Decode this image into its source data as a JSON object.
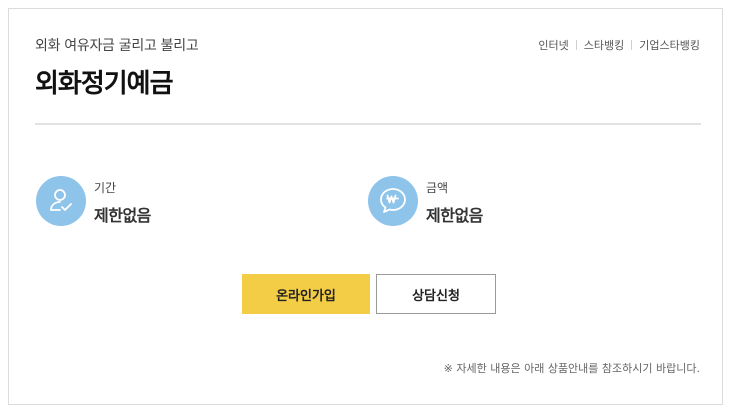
{
  "product": {
    "subtitle": "외화 여유자금 굴리고 불리고",
    "title": "외화정기예금"
  },
  "channels": [
    "인터넷",
    "스타뱅킹",
    "기업스타뱅킹"
  ],
  "info": {
    "period": {
      "icon": "person-check-icon",
      "label": "기간",
      "value": "제한없음"
    },
    "amount": {
      "icon": "won-speech-bubble-icon",
      "label": "금액",
      "value": "제한없음"
    }
  },
  "buttons": {
    "join_label": "온라인가입",
    "consult_label": "상담신청"
  },
  "notice": "※ 자세한 내용은 아래 상품안내를 참조하시기 바랍니다.",
  "colors": {
    "accent_yellow": "#f3cd45",
    "icon_blue": "#8ec3ea",
    "border_gray": "#dcdcdc"
  }
}
